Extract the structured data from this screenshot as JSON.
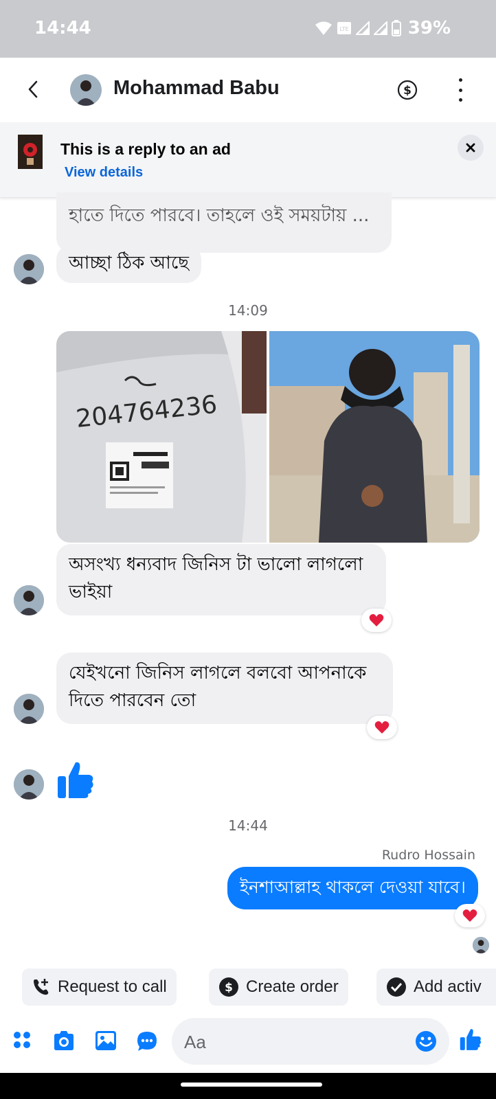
{
  "status_bar": {
    "time": "14:44",
    "battery": "39%",
    "icons": [
      "wifi-icon",
      "volte-icon",
      "signal-icon",
      "signal-icon",
      "battery-icon"
    ]
  },
  "header": {
    "contact_name": "Mohammad Babu",
    "icons": [
      "back-icon",
      "dollar-icon",
      "more-icon"
    ]
  },
  "ad_banner": {
    "title": "This is a reply to an ad",
    "link": "View details"
  },
  "messages": {
    "m1_partial": "হাতে দিতে পারবে। তাহলে ওই সময়টায় ...",
    "m2": "আচ্ছা ঠিক আছে",
    "ts1": "14:09",
    "m3": "অসংখ্য ধন্যবাদ জিনিস টা ভালো লাগলো ভাইয়া",
    "m4": "যেইখনো জিনিস লাগলে বলবো আপনাকে দিতে পারবেন তো",
    "ts2": "14:44",
    "sender": "Rudro Hossain",
    "m5": "ইনশাআল্লাহ থাকলে দেওয়া যাবে।",
    "photo_note": "204764236"
  },
  "chips": {
    "request_call": "Request to call",
    "create_order": "Create order",
    "add_activity": "Add activ"
  },
  "composer": {
    "placeholder": "Aa"
  },
  "colors": {
    "accent": "#0a7cff",
    "incoming_bubble": "#f0f0f3",
    "reaction_heart": "#e41e3f",
    "status_bar_bg": "#c8cacd"
  }
}
